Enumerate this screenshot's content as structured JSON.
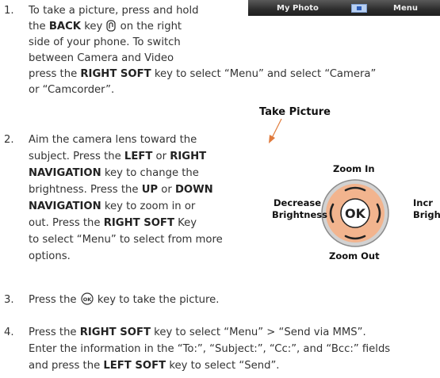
{
  "screen": {
    "left_label": "My Photo",
    "right_label": "Menu"
  },
  "items": [
    {
      "num": "1.",
      "lines": [
        "To take a picture, press and hold",
        [
          "the ",
          {
            "b": "BACK"
          },
          " key ",
          {
            "icon": "back-key"
          },
          " on the right"
        ],
        "side of your phone. To switch",
        "between Camera and Video",
        [
          "press the ",
          {
            "b": "RIGHT SOFT"
          },
          " key to select “Menu” and select “Camera”"
        ],
        "or “Camcorder”."
      ]
    },
    {
      "num": "2.",
      "lines": [
        "Aim the camera lens toward the",
        [
          "subject. Press the ",
          {
            "b": "LEFT"
          },
          " or ",
          {
            "b": "RIGHT"
          }
        ],
        [
          {
            "b": "NAVIGATION"
          },
          " key to change the"
        ],
        [
          "brightness. Press the ",
          {
            "b": "UP"
          },
          " or ",
          {
            "b": "DOWN"
          }
        ],
        [
          {
            "b": "NAVIGATION"
          },
          " key to zoom in or"
        ],
        [
          "out. Press the ",
          {
            "b": "RIGHT SOFT"
          },
          " Key"
        ],
        "to select “Menu” to select  from more",
        "options."
      ]
    },
    {
      "num": "3.",
      "lines": [
        [
          "Press the ",
          {
            "icon": "ok-key"
          },
          " key to take the picture."
        ]
      ]
    },
    {
      "num": "4.",
      "lines": [
        [
          "Press the ",
          {
            "b": "RIGHT SOFT"
          },
          " key to select “Menu” > “Send via MMS”."
        ],
        "Enter the information in the “To:”, “Subject:”, “Cc:”, and “Bcc:” fields",
        [
          "and press the ",
          {
            "b": "LEFT SOFT"
          },
          " key to select “Send”."
        ]
      ]
    }
  ],
  "diagram": {
    "title": "Take Picture",
    "zoom_in": "Zoom In",
    "zoom_out": "Zoom Out",
    "decrease_1": "Decrease",
    "decrease_2": "Brightness",
    "increase_1": "Incr",
    "increase_2": "Brigh",
    "center": "OK"
  },
  "colors": {
    "pad_fill": "#f2b48e",
    "pad_rim": "#8c8c8c",
    "text": "#333333"
  }
}
